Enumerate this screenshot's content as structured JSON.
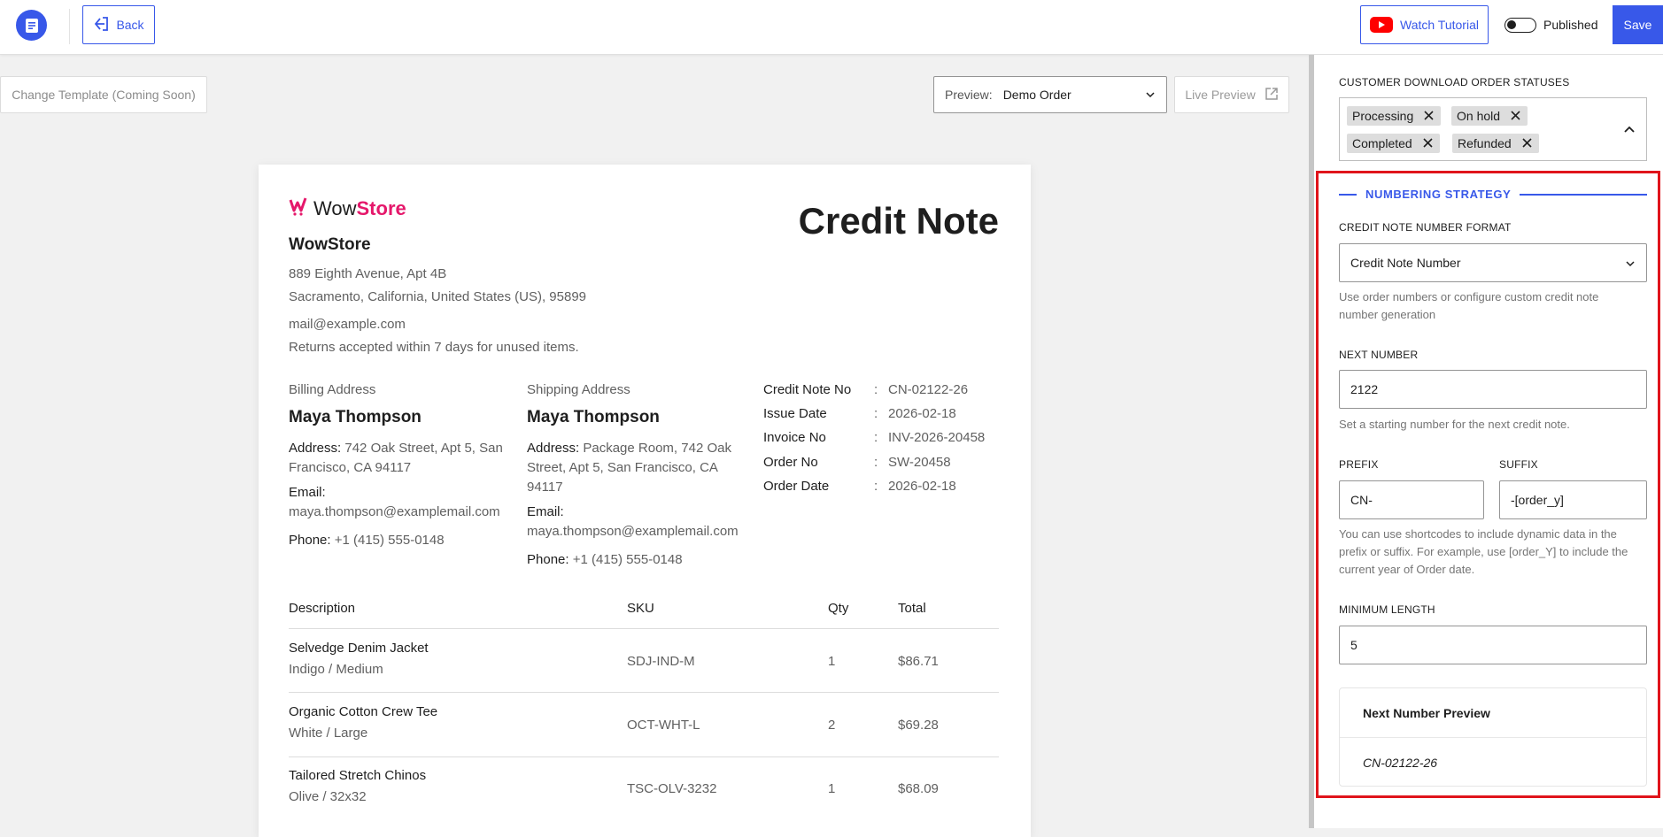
{
  "header": {
    "back_label": "Back",
    "tutorial_label": "Watch Tutorial",
    "published_label": "Published",
    "save_label": "Save"
  },
  "toolbar": {
    "change_template_label": "Change Template (Coming Soon)",
    "preview_label": "Preview:",
    "preview_value": "Demo Order",
    "live_preview_label": "Live Preview"
  },
  "document": {
    "brand_wow": "Wow",
    "brand_store": "Store",
    "title": "Credit Note",
    "store_name": "WowStore",
    "address_line1": "889 Eighth Avenue, Apt 4B",
    "address_line2": "Sacramento, California, United States (US), 95899",
    "email": "mail@example.com",
    "returns_note": "Returns accepted within 7 days for unused items.",
    "billing": {
      "heading": "Billing Address",
      "name": "Maya Thompson",
      "address_label": "Address:",
      "address_value": " 742 Oak Street, Apt 5, San Francisco, CA 94117",
      "email_label": "Email:",
      "email_value": "maya.thompson@examplemail.com",
      "phone_label": "Phone:",
      "phone_value": " +1 (415) 555-0148"
    },
    "shipping": {
      "heading": "Shipping Address",
      "name": "Maya Thompson",
      "address_label": "Address:",
      "address_value": " Package Room, 742 Oak Street, Apt 5, San Francisco, CA 94117",
      "email_label": "Email:",
      "email_value": "maya.thompson@examplemail.com",
      "phone_label": "Phone:",
      "phone_value": " +1 (415) 555-0148"
    },
    "meta": [
      {
        "key": "Credit Note No",
        "value": "CN-02122-26"
      },
      {
        "key": "Issue Date",
        "value": "2026-02-18"
      },
      {
        "key": "Invoice No",
        "value": "INV-2026-20458"
      },
      {
        "key": "Order No",
        "value": "SW-20458"
      },
      {
        "key": "Order Date",
        "value": "2026-02-18"
      }
    ],
    "meta_colon": ":",
    "table_headers": {
      "description": "Description",
      "sku": "SKU",
      "qty": "Qty",
      "total": "Total"
    },
    "items": [
      {
        "name": "Selvedge Denim Jacket",
        "variant": "Indigo / Medium",
        "sku": "SDJ-IND-M",
        "qty": "1",
        "total": "$86.71"
      },
      {
        "name": "Organic Cotton Crew Tee",
        "variant": "White / Large",
        "sku": "OCT-WHT-L",
        "qty": "2",
        "total": "$69.28"
      },
      {
        "name": "Tailored Stretch Chinos",
        "variant": "Olive / 32x32",
        "sku": "TSC-OLV-3232",
        "qty": "1",
        "total": "$68.09"
      }
    ]
  },
  "panel": {
    "statuses_label": "CUSTOMER DOWNLOAD ORDER STATUSES",
    "statuses": [
      "Processing",
      "On hold",
      "Completed",
      "Refunded"
    ],
    "strategy_title": "NUMBERING STRATEGY",
    "format_label": "CREDIT NOTE NUMBER FORMAT",
    "format_value": "Credit Note Number",
    "format_help": "Use order numbers or configure custom credit note number generation",
    "next_number_label": "NEXT NUMBER",
    "next_number_value": "2122",
    "next_number_help": "Set a starting number for the next credit note.",
    "prefix_label": "PREFIX",
    "prefix_value": "CN-",
    "suffix_label": "SUFFIX",
    "suffix_value": "-[order_y]",
    "shortcode_help": "You can use shortcodes to include dynamic data in the prefix or suffix. For example, use [order_Y] to include the current year of Order date.",
    "min_length_label": "MINIMUM LENGTH",
    "min_length_value": "5",
    "preview_heading": "Next Number Preview",
    "preview_value": "CN-02122-26"
  },
  "colors": {
    "accent": "#3858e9",
    "brand_pink": "#e5186b",
    "highlight": "#e0141b",
    "youtube": "#ff0000"
  }
}
